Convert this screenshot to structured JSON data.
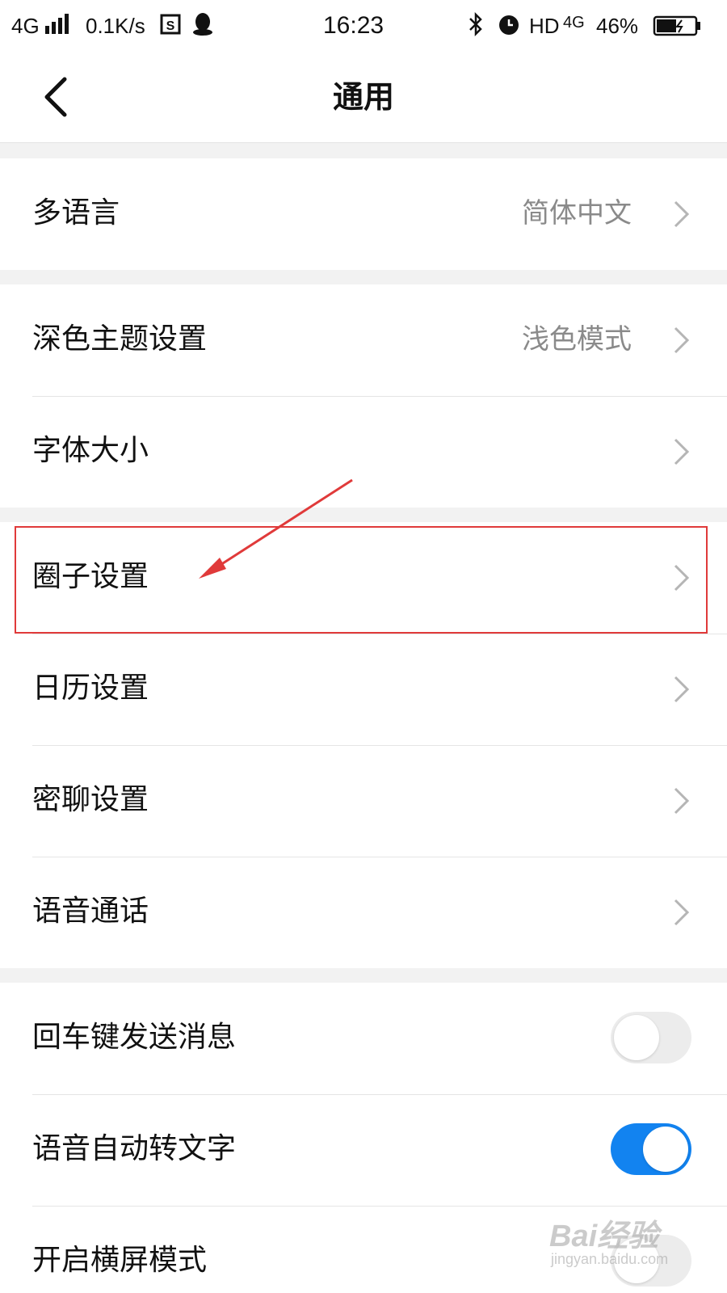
{
  "status_bar": {
    "network": "4G",
    "speed": "0.1K/s",
    "time": "16:23",
    "hd": "HD",
    "network2": "4G",
    "battery": "46%"
  },
  "header": {
    "title": "通用"
  },
  "sections": [
    {
      "items": [
        {
          "label": "多语言",
          "value": "简体中文"
        }
      ]
    },
    {
      "items": [
        {
          "label": "深色主题设置",
          "value": "浅色模式"
        },
        {
          "label": "字体大小",
          "value": ""
        }
      ]
    },
    {
      "items": [
        {
          "label": "圈子设置",
          "value": ""
        },
        {
          "label": "日历设置",
          "value": ""
        },
        {
          "label": "密聊设置",
          "value": ""
        },
        {
          "label": "语音通话",
          "value": ""
        }
      ]
    },
    {
      "items": [
        {
          "label": "回车键发送消息",
          "toggle": false
        },
        {
          "label": "语音自动转文字",
          "toggle": true
        },
        {
          "label": "开启横屏模式",
          "toggle": false
        }
      ]
    }
  ],
  "colors": {
    "accent": "#1283f0",
    "highlight": "#e03a3a"
  },
  "watermark": {
    "brand": "Bai经验",
    "url": "jingyan.baidu.com"
  }
}
